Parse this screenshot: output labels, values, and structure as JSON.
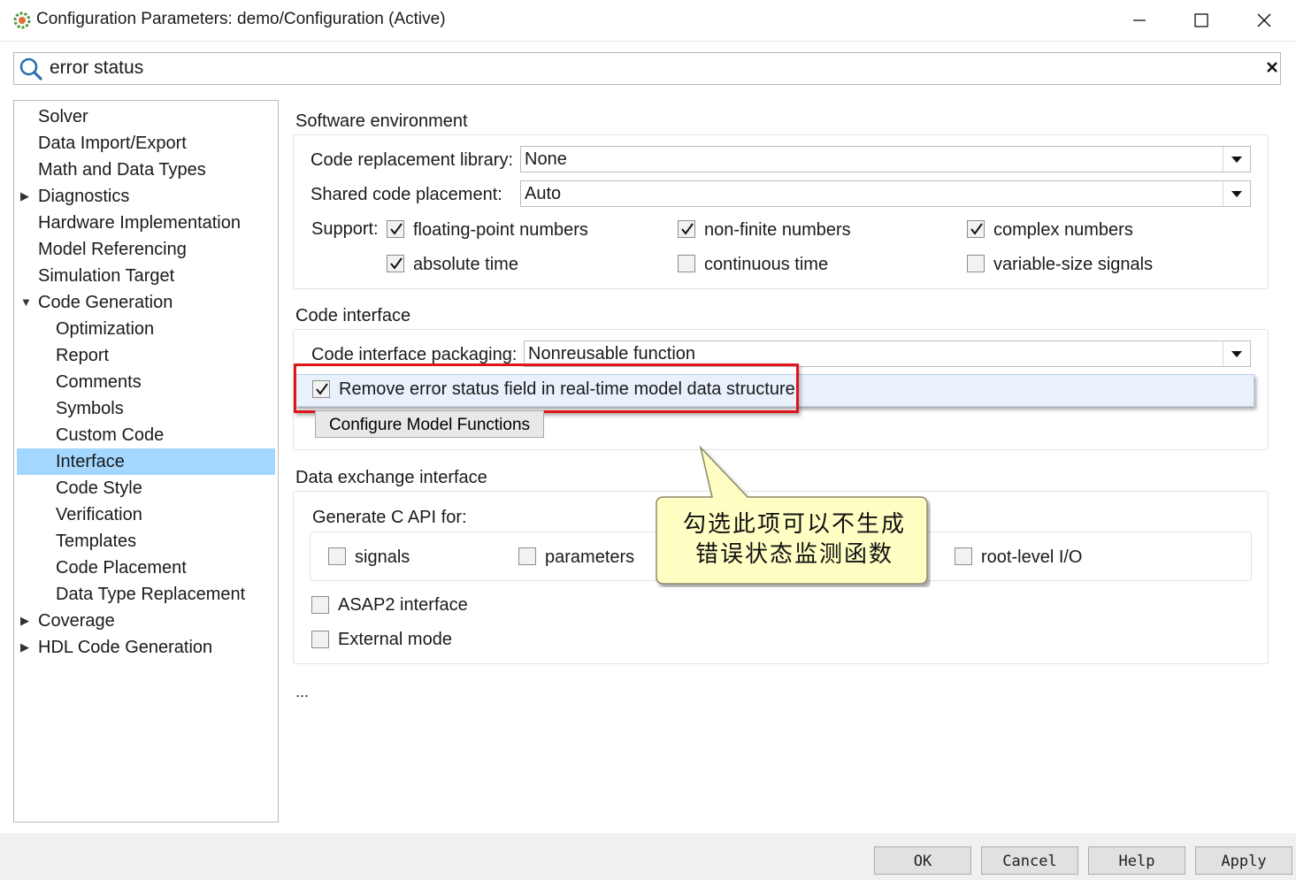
{
  "window": {
    "title": "Configuration Parameters: demo/Configuration (Active)",
    "icon": "simulink-gear-icon"
  },
  "search": {
    "value": "error status",
    "clear_label": "✕"
  },
  "tree": {
    "items": [
      {
        "label": "Solver",
        "level": 0,
        "expander": "none"
      },
      {
        "label": "Data Import/Export",
        "level": 0,
        "expander": "none"
      },
      {
        "label": "Math and Data Types",
        "level": 0,
        "expander": "none"
      },
      {
        "label": "Diagnostics",
        "level": 0,
        "expander": "collapsed"
      },
      {
        "label": "Hardware Implementation",
        "level": 0,
        "expander": "none"
      },
      {
        "label": "Model Referencing",
        "level": 0,
        "expander": "none"
      },
      {
        "label": "Simulation Target",
        "level": 0,
        "expander": "none"
      },
      {
        "label": "Code Generation",
        "level": 0,
        "expander": "expanded"
      },
      {
        "label": "Optimization",
        "level": 1,
        "expander": "none"
      },
      {
        "label": "Report",
        "level": 1,
        "expander": "none"
      },
      {
        "label": "Comments",
        "level": 1,
        "expander": "none"
      },
      {
        "label": "Symbols",
        "level": 1,
        "expander": "none"
      },
      {
        "label": "Custom Code",
        "level": 1,
        "expander": "none"
      },
      {
        "label": "Interface",
        "level": 1,
        "expander": "none",
        "selected": true
      },
      {
        "label": "Code Style",
        "level": 1,
        "expander": "none"
      },
      {
        "label": "Verification",
        "level": 1,
        "expander": "none"
      },
      {
        "label": "Templates",
        "level": 1,
        "expander": "none"
      },
      {
        "label": "Code Placement",
        "level": 1,
        "expander": "none"
      },
      {
        "label": "Data Type Replacement",
        "level": 1,
        "expander": "none"
      },
      {
        "label": "Coverage",
        "level": 0,
        "expander": "collapsed"
      },
      {
        "label": "HDL Code Generation",
        "level": 0,
        "expander": "collapsed"
      }
    ]
  },
  "software_env": {
    "title": "Software environment",
    "crl_label": "Code replacement library:",
    "crl_value": "None",
    "shared_label": "Shared code placement:",
    "shared_value": "Auto",
    "support_label": "Support:",
    "support": [
      {
        "label": "floating-point numbers",
        "checked": true
      },
      {
        "label": "non-finite numbers",
        "checked": true
      },
      {
        "label": "complex numbers",
        "checked": true
      },
      {
        "label": "absolute time",
        "checked": true
      },
      {
        "label": "continuous time",
        "checked": false
      },
      {
        "label": "variable-size signals",
        "checked": false
      }
    ]
  },
  "code_interface": {
    "title": "Code interface",
    "packaging_label": "Code interface packaging:",
    "packaging_value": "Nonreusable function",
    "remove_error_label": "Remove error status field in real-time model data structure",
    "remove_error_checked": true,
    "configure_button": "Configure Model Functions"
  },
  "data_exchange": {
    "title": "Data exchange interface",
    "capi_label": "Generate C API for:",
    "capi": [
      {
        "label": "signals",
        "checked": false
      },
      {
        "label": "parameters",
        "checked": false
      },
      {
        "label": "root-level I/O",
        "checked": false
      }
    ],
    "asap2_label": "ASAP2 interface",
    "external_label": "External mode"
  },
  "ellipsis": "...",
  "callout": {
    "line1": "勾选此项可以不生成",
    "line2": "错误状态监测函数"
  },
  "footer": {
    "ok": "OK",
    "cancel": "Cancel",
    "help": "Help",
    "apply": "Apply"
  },
  "colors": {
    "selection": "#a3d7ff",
    "highlight_row": "#e8f1fc",
    "annotation_red": "#e0141b",
    "callout_fill": "#ffffc4"
  }
}
